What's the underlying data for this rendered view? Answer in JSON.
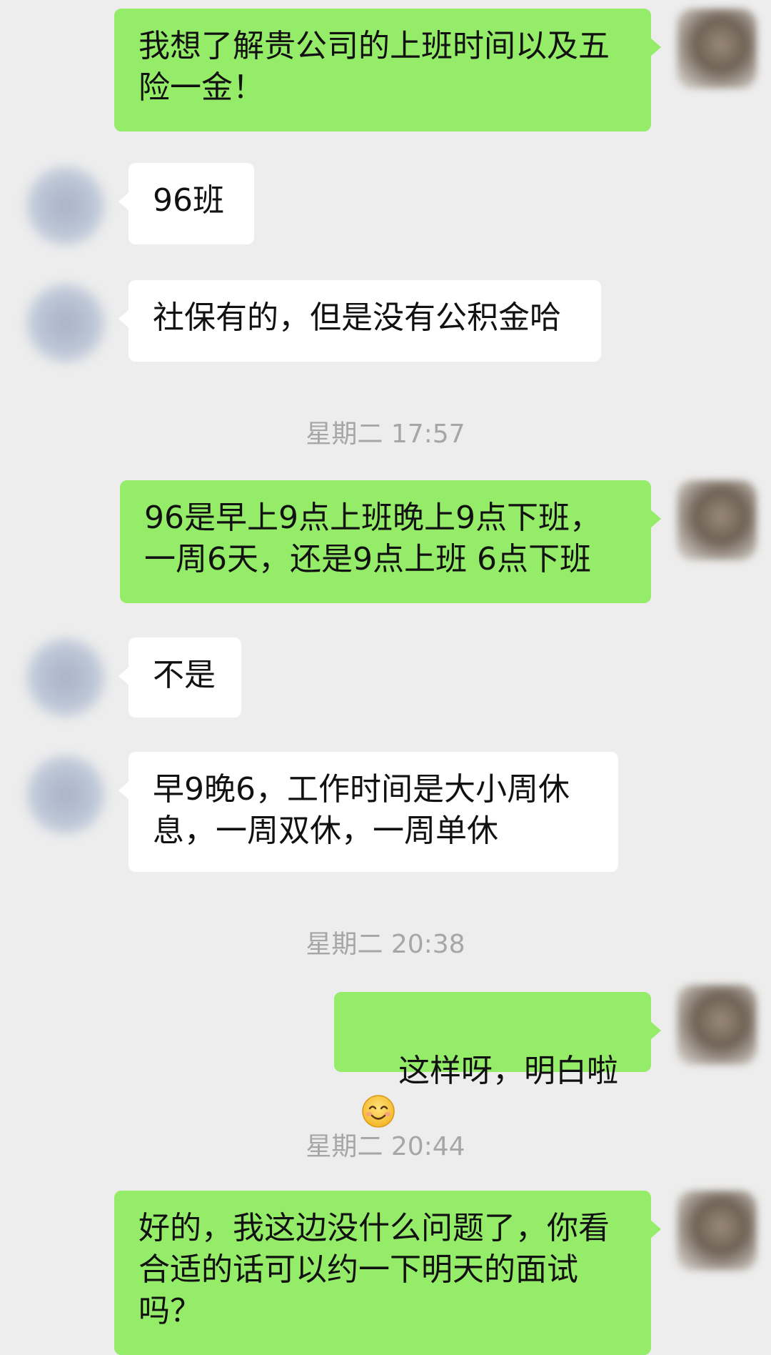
{
  "messages": [
    {
      "side": "me",
      "text": "我想了解贵公司的上班时间以及五险一金！"
    },
    {
      "side": "them",
      "text": "96班"
    },
    {
      "side": "them",
      "text": "社保有的，但是没有公积金哈"
    },
    {
      "type": "timestamp",
      "text": "星期二 17:57"
    },
    {
      "side": "me",
      "text": "96是早上9点上班晚上9点下班，一周6天，还是9点上班 6点下班"
    },
    {
      "side": "them",
      "text": "不是"
    },
    {
      "side": "them",
      "text": "早9晚6，工作时间是大小周休息，一周双休，一周单休"
    },
    {
      "type": "timestamp",
      "text": "星期二 20:38"
    },
    {
      "side": "me",
      "text": "这样呀，明白啦",
      "emoji": "smiling-face-emoji"
    },
    {
      "type": "timestamp",
      "text": "星期二 20:44"
    },
    {
      "side": "me",
      "text": "好的，我这边没什么问题了，你看合适的话可以约一下明天的面试吗？"
    }
  ],
  "icons": {
    "my_avatar": "user-avatar-blurred",
    "their_avatar": "contact-avatar-blurred"
  }
}
